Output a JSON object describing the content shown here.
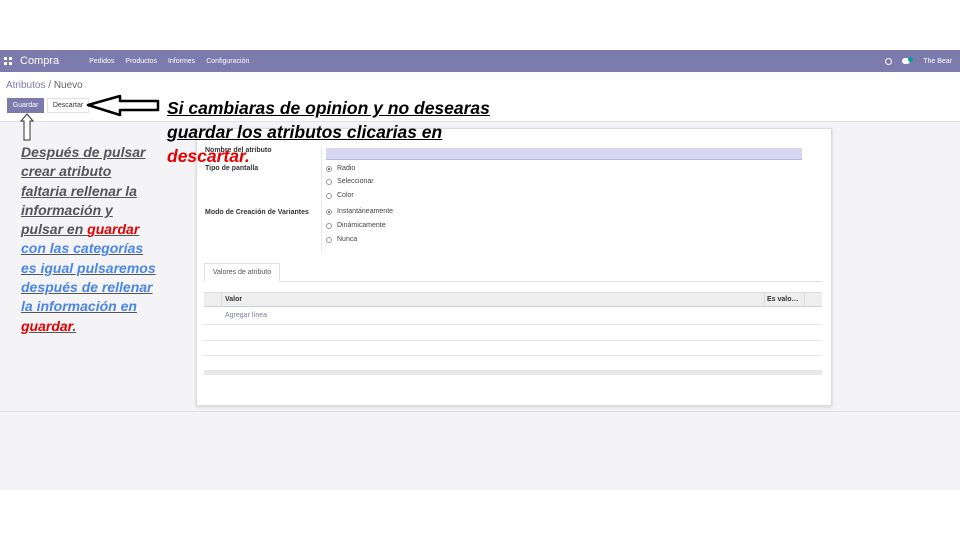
{
  "navbar": {
    "brand": "Compra",
    "menu": [
      "Pedidos",
      "Productos",
      "Informes",
      "Configuración"
    ],
    "user": "The Bear",
    "color": "#7c7bad"
  },
  "breadcrumb": {
    "parent": "Atributos",
    "separator": "/",
    "current": "Nuevo"
  },
  "buttons": {
    "save": "Guardar",
    "discard": "Descartar"
  },
  "form": {
    "name_label": "Nombre del atributo",
    "name_value": "",
    "display_type_label": "Tipo de pantalla",
    "display_options": [
      "Radio",
      "Seleccionar",
      "Color"
    ],
    "display_selected": "Radio",
    "variant_label": "Modo de Creación de Variantes",
    "variant_options": [
      "Instantáneamente",
      "Dinámicamente",
      "Nunca"
    ],
    "variant_selected": "Instantáneamente"
  },
  "tabs": [
    "Valores de atributo"
  ],
  "table": {
    "columns": [
      "Valor",
      "Es valo…"
    ],
    "add_line": "Agregar línea"
  },
  "annotations": {
    "right": {
      "line1": "Si cambiaras de opinion y no desearas",
      "line2": "guardar los atributos clicarias en",
      "line3": "descartar."
    },
    "left": {
      "l1": "Después de pulsar",
      "l2": "crear atributo",
      "l3": "faltaria rellenar la",
      "l4": "información y",
      "l5a": "pulsar en ",
      "l5b": "guardar",
      "l6": "con las categorías",
      "l7": "es igual pulsaremos",
      "l8": "después de rellenar",
      "l9": "la información en",
      "l10a": "guardar",
      "l10b": "."
    }
  }
}
